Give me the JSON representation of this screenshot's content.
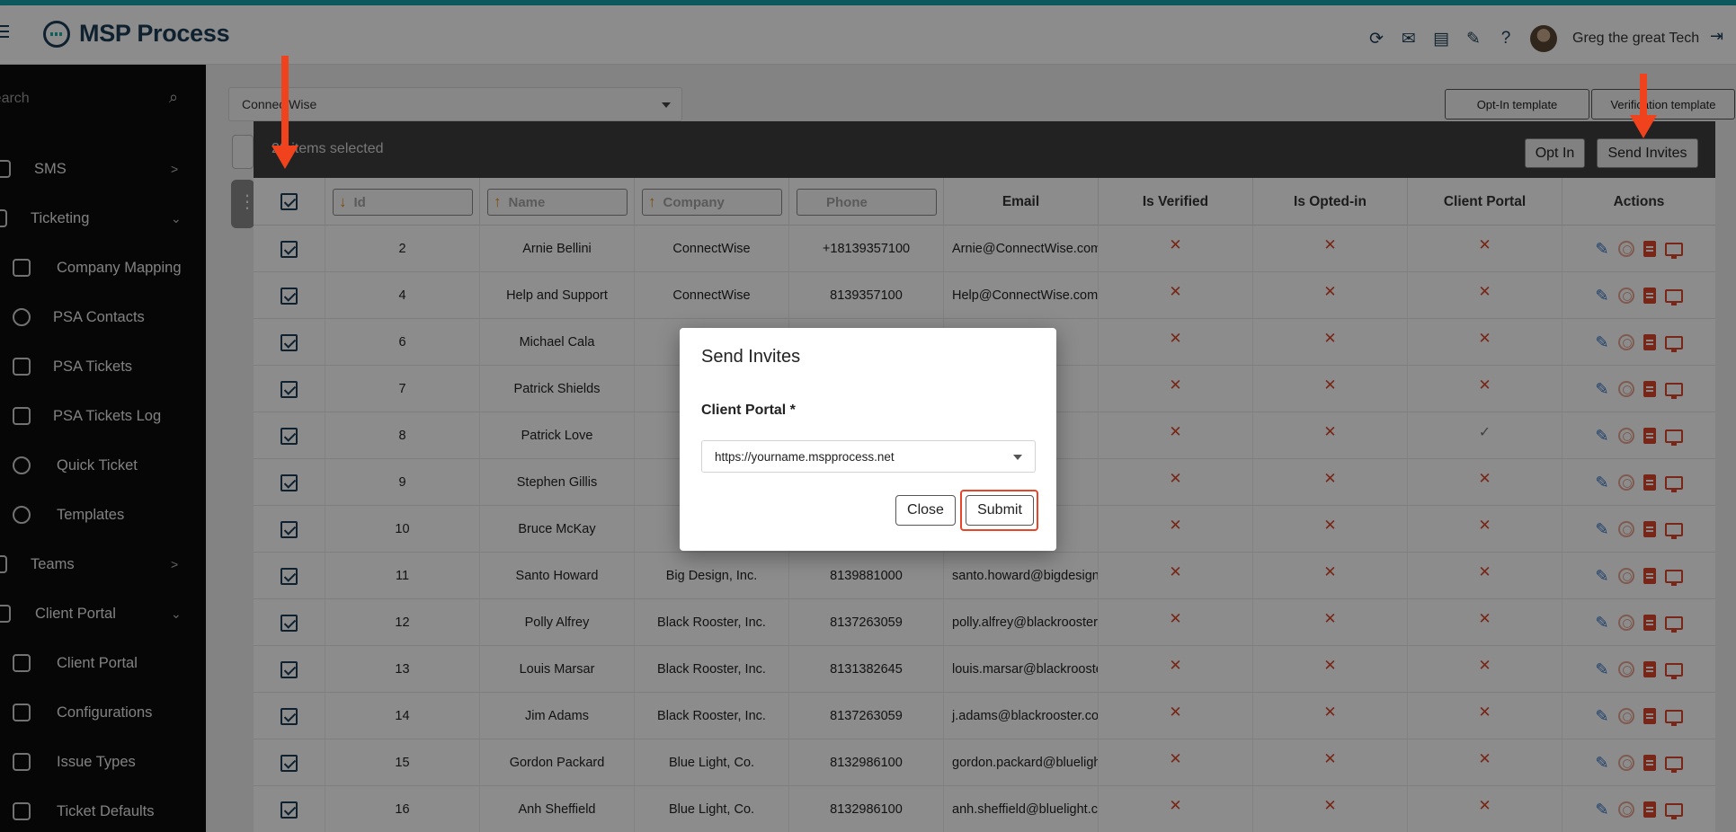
{
  "app": {
    "title": "MSP Process"
  },
  "header": {
    "username": "Greg the great Tech",
    "icons": [
      "refresh-icon",
      "mail-icon",
      "chat-icon",
      "message-edit-icon",
      "help-icon",
      "logout-icon"
    ]
  },
  "sidebar": {
    "search_placeholder": "Search",
    "items": [
      {
        "label": "SMS",
        "icon": "sms-icon",
        "chevron": ">"
      },
      {
        "label": "Ticketing",
        "icon": "ticketing-icon",
        "chevron": "⌄"
      },
      {
        "label": "Company Mapping",
        "icon": "company-mapping-icon"
      },
      {
        "label": "PSA Contacts",
        "icon": "person-icon"
      },
      {
        "label": "PSA Tickets",
        "icon": "ticket-icon"
      },
      {
        "label": "PSA Tickets Log",
        "icon": "ticket-log-icon"
      },
      {
        "label": "Quick Ticket",
        "icon": "quick-ticket-icon"
      },
      {
        "label": "Templates",
        "icon": "templates-icon"
      },
      {
        "label": "Teams",
        "icon": "teams-icon",
        "chevron": ">"
      },
      {
        "label": "Client Portal",
        "icon": "client-portal-group-icon",
        "chevron": "⌄"
      },
      {
        "label": "Client Portal",
        "icon": "client-portal-icon"
      },
      {
        "label": "Configurations",
        "icon": "configurations-icon"
      },
      {
        "label": "Issue Types",
        "icon": "issue-types-icon"
      },
      {
        "label": "Ticket Defaults",
        "icon": "ticket-defaults-icon"
      }
    ]
  },
  "main": {
    "psa_selected": "ConnectWise",
    "opt_in_template_label": "Opt-In template",
    "verification_template_label": "Verification template"
  },
  "grid": {
    "selection_text": "28 items selected",
    "opt_in_label": "Opt In",
    "send_invites_label": "Send Invites",
    "columns": {
      "id_placeholder": "Id",
      "name_placeholder": "Name",
      "company_placeholder": "Company",
      "phone_placeholder": "Phone",
      "email": "Email",
      "is_verified": "Is Verified",
      "is_opted_in": "Is Opted-in",
      "client_portal": "Client Portal",
      "actions": "Actions"
    },
    "rows": [
      {
        "id": "2",
        "name": "Arnie Bellini",
        "company": "ConnectWise",
        "phone": "+18139357100",
        "email": "Arnie@ConnectWise.com",
        "verified": "✕",
        "opted": "✕",
        "portal": "✕"
      },
      {
        "id": "4",
        "name": "Help and Support",
        "company": "ConnectWise",
        "phone": "8139357100",
        "email": "Help@ConnectWise.com",
        "verified": "✕",
        "opted": "✕",
        "portal": "✕"
      },
      {
        "id": "6",
        "name": "Michael Cala",
        "company": "C",
        "phone": "",
        "email": "wise.com",
        "verified": "✕",
        "opted": "✕",
        "portal": "✕"
      },
      {
        "id": "7",
        "name": "Patrick Shields",
        "company": "C",
        "phone": "",
        "email": "wise.com",
        "verified": "✕",
        "opted": "✕",
        "portal": "✕"
      },
      {
        "id": "8",
        "name": "Patrick Love",
        "company": "Bi",
        "phone": "",
        "email": "design.co",
        "verified": "✕",
        "opted": "✕",
        "portal": "✓"
      },
      {
        "id": "9",
        "name": "Stephen Gillis",
        "company": "Bi",
        "phone": "",
        "email": "design.c",
        "verified": "✕",
        "opted": "✕",
        "portal": "✕"
      },
      {
        "id": "10",
        "name": "Bruce McKay",
        "company": "Bi",
        "phone": "",
        "email": "design.c",
        "verified": "✕",
        "opted": "✕",
        "portal": "✕"
      },
      {
        "id": "11",
        "name": "Santo Howard",
        "company": "Big Design, Inc.",
        "phone": "8139881000",
        "email": "santo.howard@bigdesign.",
        "verified": "✕",
        "opted": "✕",
        "portal": "✕"
      },
      {
        "id": "12",
        "name": "Polly Alfrey",
        "company": "Black Rooster, Inc.",
        "phone": "8137263059",
        "email": "polly.alfrey@blackrooster.",
        "verified": "✕",
        "opted": "✕",
        "portal": "✕"
      },
      {
        "id": "13",
        "name": "Louis Marsar",
        "company": "Black Rooster, Inc.",
        "phone": "8131382645",
        "email": "louis.marsar@blackrooste",
        "verified": "✕",
        "opted": "✕",
        "portal": "✕"
      },
      {
        "id": "14",
        "name": "Jim Adams",
        "company": "Black Rooster, Inc.",
        "phone": "8137263059",
        "email": "j.adams@blackrooster.com",
        "verified": "✕",
        "opted": "✕",
        "portal": "✕"
      },
      {
        "id": "15",
        "name": "Gordon Packard",
        "company": "Blue Light, Co.",
        "phone": "8132986100",
        "email": "gordon.packard@bluelight",
        "verified": "✕",
        "opted": "✕",
        "portal": "✕"
      },
      {
        "id": "16",
        "name": "Anh Sheffield",
        "company": "Blue Light, Co.",
        "phone": "8132986100",
        "email": "anh.sheffield@bluelight.cc",
        "verified": "✕",
        "opted": "✕",
        "portal": "✕"
      }
    ]
  },
  "modal": {
    "title": "Send Invites",
    "field_label": "Client Portal *",
    "selected_portal": "https://yourname.mspprocess.net",
    "close_label": "Close",
    "submit_label": "Submit"
  },
  "colors": {
    "accent": "#1d3c57",
    "teal": "#16a0a8",
    "annotation": "#f0421c",
    "error": "#d9452b"
  }
}
